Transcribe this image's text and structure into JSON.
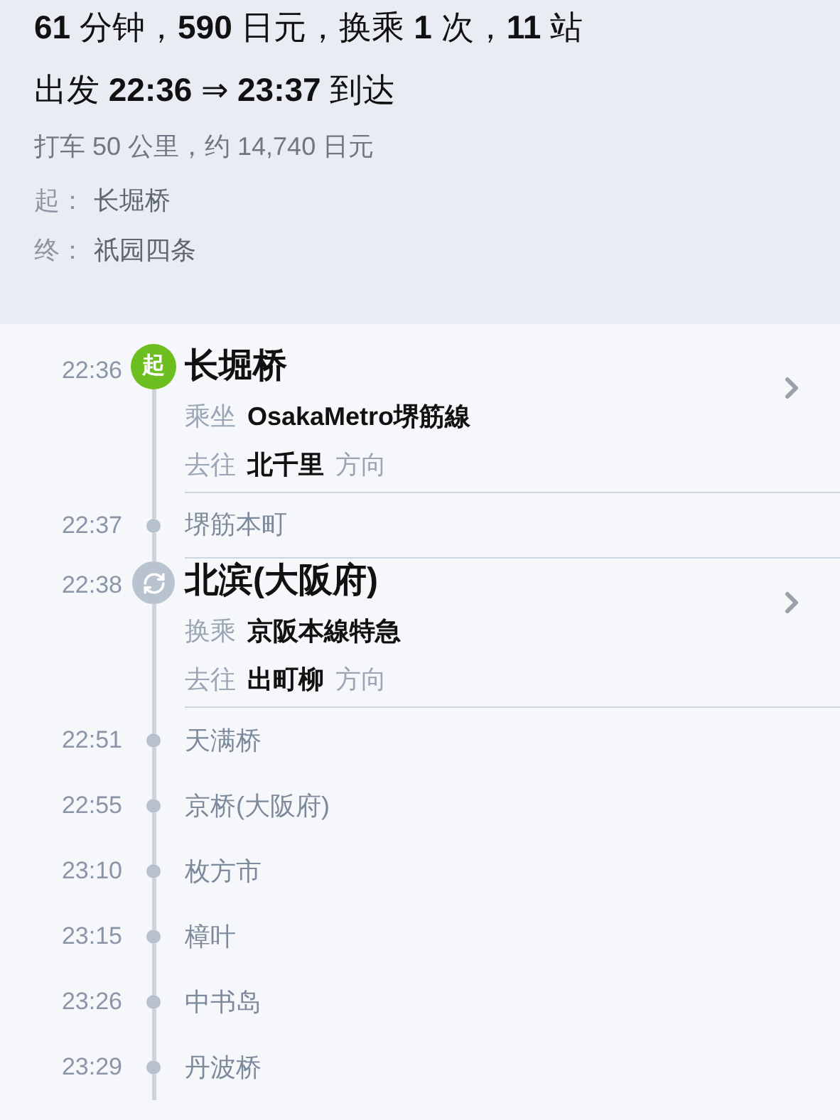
{
  "summary": {
    "line": "**61** 分钟，**590** 日元，换乘 **1** 次，**11** 站",
    "times": "出发 **22:36** ⇒ **23:37** 到达",
    "taxi": "打车 50 公里，约 14,740 日元",
    "origin": {
      "label": "起：",
      "value": "长堀桥"
    },
    "destination": {
      "label": "终：",
      "value": "祇园四条"
    }
  },
  "stops": [
    {
      "kind": "board",
      "time": "22:36",
      "badge": "起",
      "name": "长堀桥",
      "line_label": "乘坐",
      "line": "OsakaMetro堺筋線",
      "direction_label": "去往",
      "direction": "北千里",
      "direction_suffix": "方向"
    },
    {
      "kind": "stop",
      "time": "22:37",
      "name": "堺筋本町"
    },
    {
      "kind": "transfer",
      "time": "22:38",
      "name": "北滨(大阪府)",
      "line_label": "换乘",
      "line": "京阪本線特急",
      "direction_label": "去往",
      "direction": "出町柳",
      "direction_suffix": "方向"
    },
    {
      "kind": "stop",
      "time": "22:51",
      "name": "天满桥"
    },
    {
      "kind": "stop",
      "time": "22:55",
      "name": "京桥(大阪府)"
    },
    {
      "kind": "stop",
      "time": "23:10",
      "name": "枚方市"
    },
    {
      "kind": "stop",
      "time": "23:15",
      "name": "樟叶"
    },
    {
      "kind": "stop",
      "time": "23:26",
      "name": "中书岛"
    },
    {
      "kind": "stop",
      "time": "23:29",
      "name": "丹波桥"
    }
  ]
}
